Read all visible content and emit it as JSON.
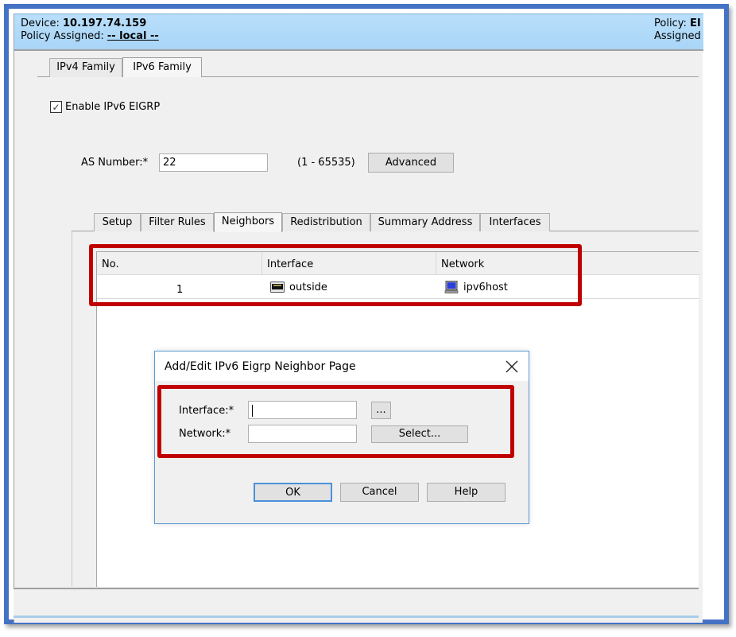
{
  "header": {
    "device_label": "Device:",
    "device_value": "10.197.74.159",
    "policy_assigned_label": "Policy Assigned:",
    "policy_assigned_value": "-- local --",
    "policy_label": "Policy:",
    "policy_value_truncated": "EI",
    "assigned_truncated": "Assigned"
  },
  "family_tabs": [
    {
      "label": "IPv4 Family",
      "active": false
    },
    {
      "label": "IPv6 Family",
      "active": true
    }
  ],
  "enable_checkbox": {
    "label": "Enable IPv6 EIGRP",
    "checked": true,
    "check_glyph": "✓"
  },
  "as_number": {
    "label": "AS Number:*",
    "value": "22",
    "range_hint": "(1 - 65535)",
    "advanced_label": "Advanced"
  },
  "sub_tabs": [
    {
      "label": "Setup",
      "active": false
    },
    {
      "label": "Filter Rules",
      "active": false
    },
    {
      "label": "Neighbors",
      "active": true
    },
    {
      "label": "Redistribution",
      "active": false
    },
    {
      "label": "Summary Address",
      "active": false
    },
    {
      "label": "Interfaces",
      "active": false
    }
  ],
  "neighbors_table": {
    "columns": [
      "No.",
      "Interface",
      "Network"
    ],
    "rows": [
      {
        "no": "1",
        "interface": "outside",
        "interface_icon": "network-port-icon",
        "network": "ipv6host",
        "network_icon": "host-computer-icon"
      }
    ]
  },
  "dialog": {
    "title": "Add/Edit IPv6 Eigrp Neighbor Page",
    "close_icon": "close-icon",
    "interface_label": "Interface:*",
    "interface_value": "",
    "interface_browse_label": "...",
    "network_label": "Network:*",
    "network_value": "",
    "select_label": "Select...",
    "ok_label": "OK",
    "cancel_label": "Cancel",
    "help_label": "Help"
  },
  "colors": {
    "frame_border": "#4472c4",
    "header_bg": "#b9dffb",
    "highlight_red": "#c00000",
    "ok_focus": "#4a90d9"
  }
}
